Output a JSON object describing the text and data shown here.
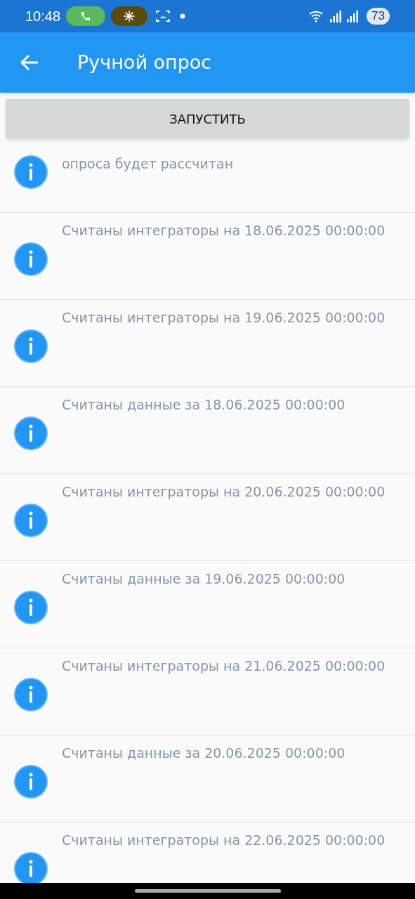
{
  "status_bar": {
    "time": "10:48",
    "battery": "73"
  },
  "app_bar": {
    "title": "Ручной опрос"
  },
  "start_button": {
    "label": "ЗАПУСТИТЬ"
  },
  "log": [
    {
      "text": "опроса будет рассчитан"
    },
    {
      "text": "Считаны интеграторы на 18.06.2025 00:00:00"
    },
    {
      "text": "Считаны интеграторы на 19.06.2025 00:00:00"
    },
    {
      "text": "Считаны данные за 18.06.2025 00:00:00"
    },
    {
      "text": "Считаны интеграторы на 20.06.2025 00:00:00"
    },
    {
      "text": "Считаны данные за 19.06.2025 00:00:00"
    },
    {
      "text": "Считаны интеграторы на 21.06.2025 00:00:00"
    },
    {
      "text": "Считаны данные за 20.06.2025 00:00:00"
    },
    {
      "text": "Считаны интеграторы на 22.06.2025 00:00:00"
    }
  ]
}
